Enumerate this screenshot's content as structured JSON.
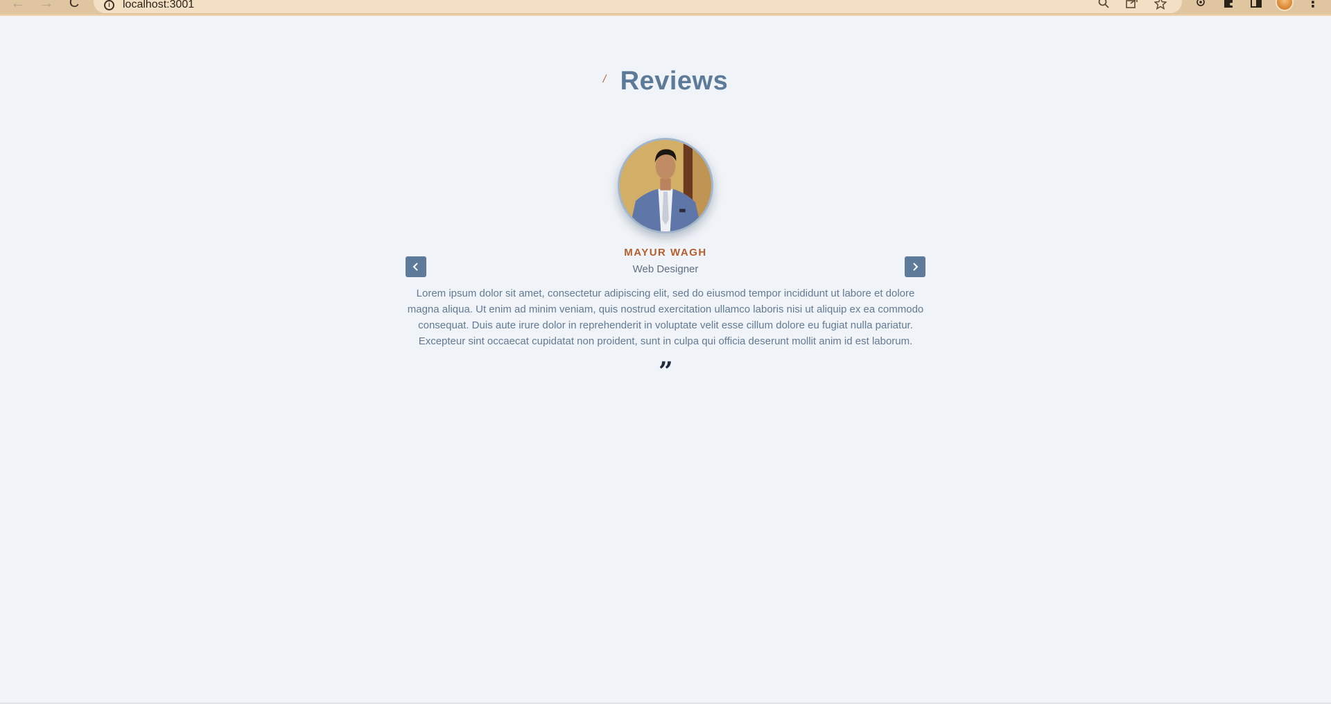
{
  "browser": {
    "url": "localhost:3001",
    "back_icon": "←",
    "forward_icon": "→",
    "reload_icon": "C",
    "info_icon": "i",
    "menu_icon": "⋮"
  },
  "section": {
    "heading_mark": "/",
    "title": "Reviews"
  },
  "review": {
    "name": "MAYUR WAGH",
    "role": "Web Designer",
    "text": "Lorem ipsum dolor sit amet, consectetur adipiscing elit, sed do eiusmod tempor incididunt ut labore et dolore magna aliqua. Ut enim ad minim veniam, quis nostrud exercitation ullamco laboris nisi ut aliquip ex ea commodo consequat. Duis aute irure dolor in reprehenderit in voluptate velit esse cillum dolore eu fugiat nulla pariatur. Excepteur sint occaecat cupidatat non proident, sunt in culpa qui officia deserunt mollit anim id est laborum.",
    "quote_mark": "”"
  },
  "colors": {
    "background": "#f0f3f7",
    "accent": "#5d7b99",
    "name": "#b45f2d",
    "browser_bar": "#e0c5a1"
  }
}
